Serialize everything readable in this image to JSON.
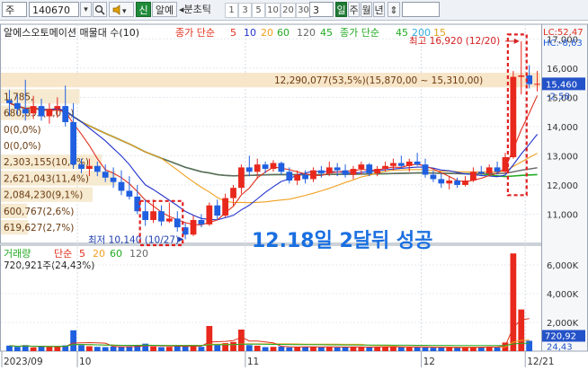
{
  "toolbar": {
    "market_label": "주",
    "code_value": "140670",
    "search_icon": "search-icon",
    "sound_icon": "speaker-icon",
    "credit_label": "신",
    "alert_label": "알예",
    "minute_label": "◂분초틱",
    "periods": [
      "1",
      "3",
      "5",
      "10",
      "20",
      "30"
    ],
    "count_value": "3",
    "day_label": "일",
    "week_label": "주",
    "month_label": "월",
    "year_label": "년",
    "scroll_icon": "updown-arrow-icon"
  },
  "chart_data": [
    {
      "type": "candlestick",
      "title": "알에스오토메이션 매물대 수(10)",
      "ma_legend_label": "종가 단순",
      "ma_periods": [
        "5",
        "10",
        "20",
        "60",
        "120",
        "45"
      ],
      "ma_colors": [
        "#e0301e",
        "#2233cc",
        "#f0a020",
        "#22aa22",
        "#666666",
        "#22aa22"
      ],
      "ma2_legend_label": "종가 단순",
      "ma2_periods": [
        "45",
        "200",
        "15"
      ],
      "ma2_colors": [
        "#22aa22",
        "#33aadd",
        "#e0a020"
      ],
      "top_right": [
        "LC:52,47",
        "HC:-8,63"
      ],
      "ylim": [
        10000,
        17500
      ],
      "y_ticks": [
        "17,000",
        "16,000",
        "15,000",
        "14,000",
        "13,000",
        "12,000",
        "11,000"
      ],
      "y_tick_values": [
        17000,
        16000,
        15000,
        14000,
        13000,
        12000,
        11000
      ],
      "current_price": "15,460",
      "current_change": "-2.58",
      "max_label": "최고 16,920 (12/20)",
      "min_label": "최저 10,140 (10/27)",
      "annotation": "12.18일 2달뒤 성공",
      "volume_profile": [
        {
          "label": "12,290,077(53,5%)(15,870,00 ~ 15,310,00)",
          "share": 53.5,
          "from": 15310,
          "to": 15870
        },
        {
          "label": "1,785,",
          "share": 7.8,
          "from": 14750,
          "to": 15310
        },
        {
          "label": "680,853(3,0%)",
          "share": 3.0,
          "from": 14190,
          "to": 14750
        },
        {
          "label": "0(0,0%)",
          "share": 0.0,
          "from": 13630,
          "to": 14190
        },
        {
          "label": "0(0,0%)",
          "share": 0.0,
          "from": 13070,
          "to": 13630
        },
        {
          "label": "2,303,155(10,0%)",
          "share": 10.0,
          "from": 12510,
          "to": 13070
        },
        {
          "label": "2,621,043(11,4%)",
          "share": 11.4,
          "from": 11950,
          "to": 12510
        },
        {
          "label": "2,084,230(9,1%)",
          "share": 9.1,
          "from": 11390,
          "to": 11950
        },
        {
          "label": "600,767(2,6%)",
          "share": 2.6,
          "from": 10830,
          "to": 11390
        },
        {
          "label": "619,627(2,7%)",
          "share": 2.7,
          "from": 10270,
          "to": 10830
        }
      ],
      "candles": [
        {
          "o": 14900,
          "h": 15250,
          "l": 14350,
          "c": 14800
        },
        {
          "o": 14800,
          "h": 15100,
          "l": 14400,
          "c": 14600
        },
        {
          "o": 14600,
          "h": 15600,
          "l": 14200,
          "c": 14450
        },
        {
          "o": 14450,
          "h": 15050,
          "l": 14250,
          "c": 14700
        },
        {
          "o": 14700,
          "h": 14950,
          "l": 14200,
          "c": 14350
        },
        {
          "o": 14350,
          "h": 14800,
          "l": 14100,
          "c": 14600
        },
        {
          "o": 14600,
          "h": 15000,
          "l": 14300,
          "c": 14700
        },
        {
          "o": 14700,
          "h": 15400,
          "l": 14000,
          "c": 14150
        },
        {
          "o": 14150,
          "h": 14800,
          "l": 12550,
          "c": 12700
        },
        {
          "o": 12700,
          "h": 12900,
          "l": 12400,
          "c": 12550
        },
        {
          "o": 12550,
          "h": 12900,
          "l": 12300,
          "c": 12650
        },
        {
          "o": 12650,
          "h": 12800,
          "l": 12300,
          "c": 12450
        },
        {
          "o": 12450,
          "h": 12700,
          "l": 12100,
          "c": 12250
        },
        {
          "o": 12250,
          "h": 12600,
          "l": 11900,
          "c": 12100
        },
        {
          "o": 12100,
          "h": 12500,
          "l": 11650,
          "c": 11800
        },
        {
          "o": 11800,
          "h": 12300,
          "l": 11500,
          "c": 11600
        },
        {
          "o": 11600,
          "h": 12000,
          "l": 11000,
          "c": 11100
        },
        {
          "o": 11100,
          "h": 11500,
          "l": 10600,
          "c": 10800
        },
        {
          "o": 10800,
          "h": 11500,
          "l": 10700,
          "c": 11100
        },
        {
          "o": 11100,
          "h": 11300,
          "l": 10600,
          "c": 10750
        },
        {
          "o": 10750,
          "h": 11400,
          "l": 10700,
          "c": 10850
        },
        {
          "o": 10850,
          "h": 11100,
          "l": 10400,
          "c": 10550
        },
        {
          "o": 10550,
          "h": 10700,
          "l": 10140,
          "c": 10300
        },
        {
          "o": 10300,
          "h": 10950,
          "l": 10250,
          "c": 10800
        },
        {
          "o": 10800,
          "h": 11000,
          "l": 10550,
          "c": 10650
        },
        {
          "o": 10650,
          "h": 11400,
          "l": 10600,
          "c": 11300
        },
        {
          "o": 11300,
          "h": 11500,
          "l": 10800,
          "c": 10950
        },
        {
          "o": 10950,
          "h": 11700,
          "l": 10900,
          "c": 11550
        },
        {
          "o": 11550,
          "h": 12000,
          "l": 11300,
          "c": 11900
        },
        {
          "o": 11900,
          "h": 12700,
          "l": 11700,
          "c": 12600
        },
        {
          "o": 12600,
          "h": 13000,
          "l": 12300,
          "c": 12450
        },
        {
          "o": 12450,
          "h": 12900,
          "l": 12200,
          "c": 12700
        },
        {
          "o": 12700,
          "h": 12800,
          "l": 12400,
          "c": 12550
        },
        {
          "o": 12550,
          "h": 12850,
          "l": 12450,
          "c": 12750
        },
        {
          "o": 12750,
          "h": 12800,
          "l": 12350,
          "c": 12450
        },
        {
          "o": 12450,
          "h": 12600,
          "l": 12050,
          "c": 12150
        },
        {
          "o": 12150,
          "h": 12500,
          "l": 12000,
          "c": 12350
        },
        {
          "o": 12350,
          "h": 12500,
          "l": 12050,
          "c": 12200
        },
        {
          "o": 12200,
          "h": 12600,
          "l": 12100,
          "c": 12500
        },
        {
          "o": 12500,
          "h": 12650,
          "l": 12250,
          "c": 12400
        },
        {
          "o": 12400,
          "h": 12800,
          "l": 12300,
          "c": 12600
        },
        {
          "o": 12600,
          "h": 12750,
          "l": 12300,
          "c": 12500
        },
        {
          "o": 12500,
          "h": 12700,
          "l": 12250,
          "c": 12350
        },
        {
          "o": 12350,
          "h": 12650,
          "l": 12200,
          "c": 12550
        },
        {
          "o": 12550,
          "h": 12800,
          "l": 12350,
          "c": 12700
        },
        {
          "o": 12700,
          "h": 12750,
          "l": 12300,
          "c": 12400
        },
        {
          "o": 12400,
          "h": 12650,
          "l": 12300,
          "c": 12550
        },
        {
          "o": 12550,
          "h": 12800,
          "l": 12450,
          "c": 12650
        },
        {
          "o": 12650,
          "h": 12900,
          "l": 12500,
          "c": 12750
        },
        {
          "o": 12750,
          "h": 13000,
          "l": 12550,
          "c": 12650
        },
        {
          "o": 12650,
          "h": 12900,
          "l": 12450,
          "c": 12800
        },
        {
          "o": 12800,
          "h": 13100,
          "l": 12650,
          "c": 12700
        },
        {
          "o": 12700,
          "h": 12900,
          "l": 12250,
          "c": 12350
        },
        {
          "o": 12350,
          "h": 12500,
          "l": 12100,
          "c": 12200
        },
        {
          "o": 12200,
          "h": 12400,
          "l": 11900,
          "c": 12050
        },
        {
          "o": 12050,
          "h": 12300,
          "l": 11850,
          "c": 12150
        },
        {
          "o": 12150,
          "h": 12250,
          "l": 11900,
          "c": 12000
        },
        {
          "o": 12000,
          "h": 12300,
          "l": 11950,
          "c": 12150
        },
        {
          "o": 12150,
          "h": 12600,
          "l": 12100,
          "c": 12450
        },
        {
          "o": 12450,
          "h": 12650,
          "l": 12300,
          "c": 12400
        },
        {
          "o": 12400,
          "h": 12700,
          "l": 12300,
          "c": 12600
        },
        {
          "o": 12600,
          "h": 12800,
          "l": 12350,
          "c": 12450
        },
        {
          "o": 12450,
          "h": 13100,
          "l": 12400,
          "c": 12950
        },
        {
          "o": 12950,
          "h": 15900,
          "l": 12900,
          "c": 15700
        },
        {
          "o": 15700,
          "h": 16920,
          "l": 15100,
          "c": 15750
        },
        {
          "o": 15750,
          "h": 16100,
          "l": 15300,
          "c": 15450
        },
        {
          "o": 15450,
          "h": 15900,
          "l": 15200,
          "c": 15460
        }
      ],
      "x_labels": [
        {
          "label": "2023/09",
          "index": 0
        },
        {
          "label": "10",
          "index": 9
        },
        {
          "label": "11",
          "index": 30
        },
        {
          "label": "12",
          "index": 52
        },
        {
          "label": "12/21",
          "index": 65
        }
      ]
    },
    {
      "type": "bar",
      "title": "거래량",
      "ma_legend_label": "단순",
      "ma_periods": [
        "5",
        "20",
        "60",
        "120"
      ],
      "ma_colors": [
        "#e0301e",
        "#f0a020",
        "#22aa22",
        "#666666"
      ],
      "last_value_label": "720,921주(24,43%)",
      "current_label": "720,92",
      "current_pct": "24,43",
      "ylim": [
        0,
        7000000
      ],
      "y_ticks": [
        "6,000K",
        "4,000K",
        "2,000K"
      ],
      "y_tick_values": [
        6000000,
        4000000,
        2000000
      ],
      "values": [
        380000,
        300000,
        420000,
        260000,
        320000,
        300000,
        350000,
        400000,
        1450000,
        420000,
        340000,
        300000,
        280000,
        320000,
        300000,
        350000,
        380000,
        520000,
        320000,
        280000,
        300000,
        340000,
        420000,
        380000,
        300000,
        1750000,
        420000,
        560000,
        640000,
        1500000,
        420000,
        380000,
        280000,
        300000,
        320000,
        260000,
        280000,
        300000,
        320000,
        280000,
        300000,
        260000,
        280000,
        320000,
        300000,
        260000,
        280000,
        300000,
        320000,
        300000,
        280000,
        300000,
        260000,
        240000,
        250000,
        260000,
        240000,
        260000,
        280000,
        300000,
        320000,
        300000,
        600000,
        6800000,
        2900000,
        720921
      ]
    }
  ]
}
